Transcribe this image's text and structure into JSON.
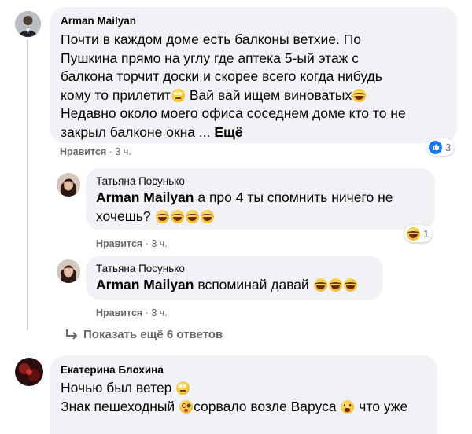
{
  "comments": [
    {
      "author": "Arman Mailyan",
      "text_lines": [
        "Почти в каждом доме есть балконы ветхие. По",
        "Пушкина прямо на углу где аптека 5-ый этаж с",
        "балкона торчит доски и скорее всего когда нибудь",
        "кому то прилетит",
        " Вай вай ищем виноватых",
        "Недавно около моего офиса соседнем доме кто то не",
        "закрыл балконе окна ... ",
        "Ещё"
      ],
      "like_label": "Нравится",
      "dot": "·",
      "time": "3 ч.",
      "reaction_count": "3",
      "reaction_icon": "like-icon"
    }
  ],
  "replies": [
    {
      "author": "Татьяна Посунько",
      "mention": "Arman Mailyan",
      "text_line1": " а про 4 ты спомнить ничего не",
      "text_line2": "хочешь? ",
      "like_label": "Нравится",
      "dot": "·",
      "time": "3 ч.",
      "reaction_count": "1",
      "reaction_icon": "laugh-reaction-icon"
    },
    {
      "author": "Татьяна Посунько",
      "mention": "Arman Mailyan",
      "text_line1": " вспоминай давай ",
      "like_label": "Нравится",
      "dot": "·",
      "time": "3 ч."
    }
  ],
  "show_more": {
    "icon": "reply-arrow-icon",
    "label": "Показать ещё 6 ответов"
  },
  "comment2": {
    "author": "Екатерина Блохина",
    "line1": "Ночью был ветер ",
    "line2a": "Знак пешеходный ",
    "line2b": "сорвало возле Варуса ",
    "line2c": " что уже"
  },
  "colors": {
    "bubble": "#f0f2f5",
    "meta_text": "#65676b",
    "like_blue": "#1877f2",
    "thread_line": "#ced0d4"
  }
}
